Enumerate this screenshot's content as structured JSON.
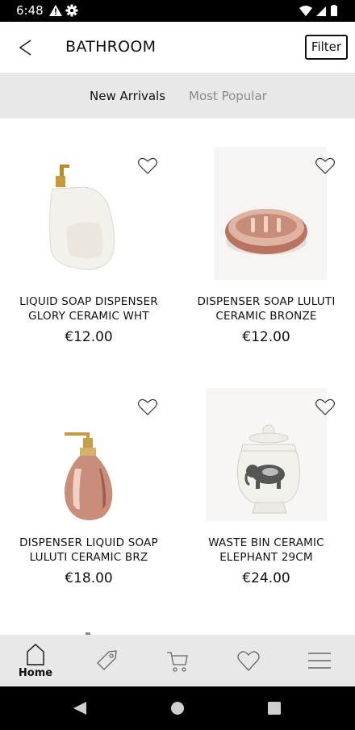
{
  "status_bar": {
    "time": "6:48"
  },
  "header": {
    "title": "BATHROOM",
    "filter_label": "Filter"
  },
  "tabs": [
    {
      "label": "New Arrivals",
      "active": true
    },
    {
      "label": "Most Popular",
      "active": false
    }
  ],
  "products": [
    {
      "name_line1": "LIQUID SOAP DISPENSER",
      "name_line2": "GLORY CERAMIC WHT",
      "price": "€12.00"
    },
    {
      "name_line1": "DISPENSER SOAP LULUTI",
      "name_line2": "CERAMIC BRONZE",
      "price": "€12.00"
    },
    {
      "name_line1": "DISPENSER LIQUID SOAP",
      "name_line2": "LULUTI CERAMIC BRZ",
      "price": "€18.00"
    },
    {
      "name_line1": "WASTE BIN CERAMIC",
      "name_line2": "ELEPHANT 29CM",
      "price": "€24.00"
    }
  ],
  "bottom_nav": {
    "home_label": "Home",
    "items": [
      "home-icon",
      "tag-icon",
      "cart-icon",
      "heart-icon",
      "menu-icon"
    ]
  },
  "colors": {
    "tab_bar_bg": "#e8e8e8",
    "bronze": "#c98f7a",
    "ceramic_white": "#f2f0eb"
  }
}
